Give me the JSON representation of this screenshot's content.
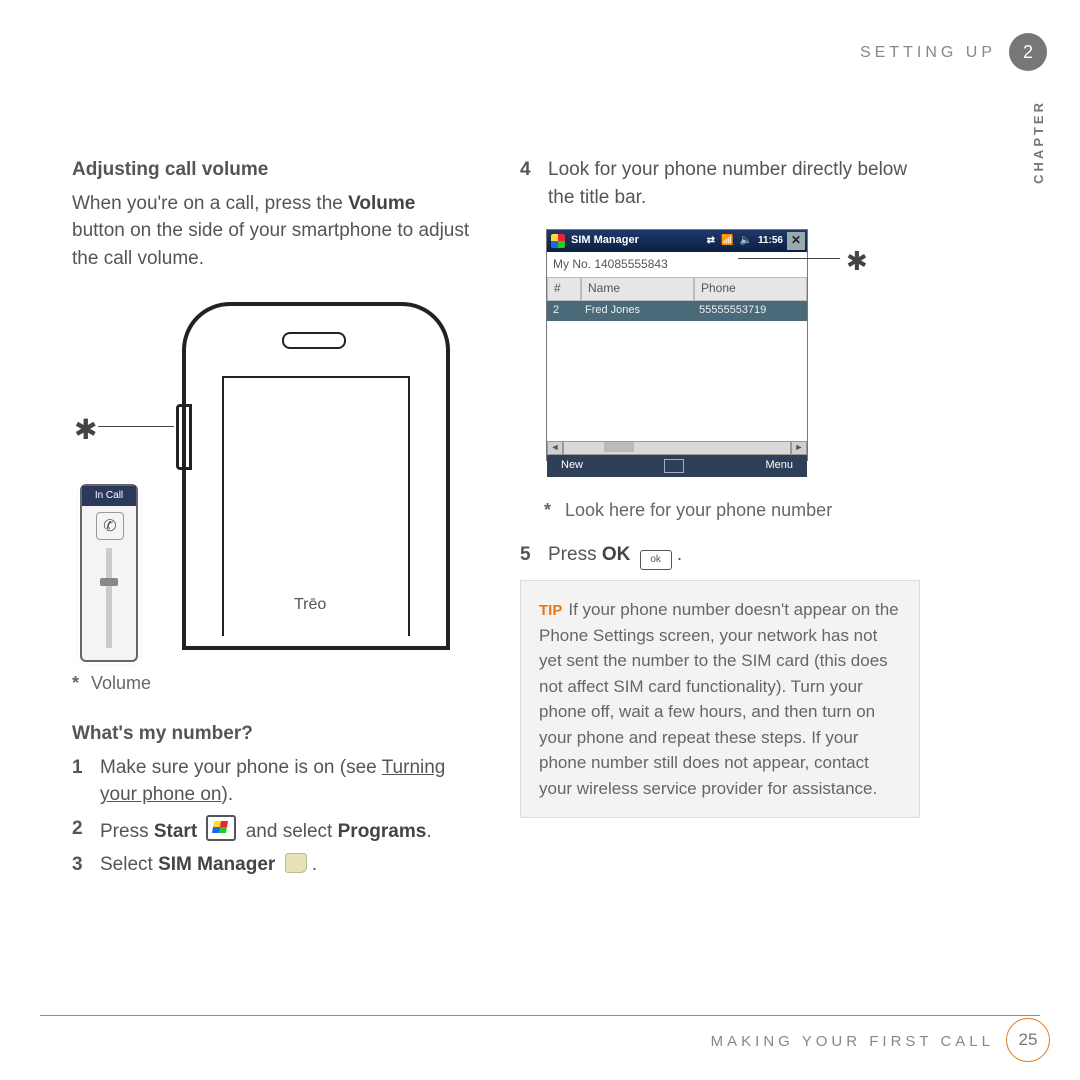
{
  "header": {
    "section": "SETTING UP",
    "chapter_num": "2",
    "side_label": "CHAPTER"
  },
  "footer": {
    "section": "MAKING YOUR FIRST CALL",
    "page": "25"
  },
  "left": {
    "h_adjust": "Adjusting call volume",
    "adjust_body_1": "When you're on a call, press the ",
    "adjust_body_bold": "Volume",
    "adjust_body_2": " button on the side of your smartphone to adjust the call volume.",
    "incall_label": "In Call",
    "phone_logo": "Trēo",
    "caption_volume": "Volume",
    "h_number": "What's my number?",
    "steps": {
      "one_a": "Make sure your phone is on (see ",
      "one_link": "Turning your phone on",
      "one_b": ").",
      "two_a": "Press ",
      "two_start": "Start",
      "two_b": " and select ",
      "two_programs": "Programs",
      "two_c": ".",
      "three_a": "Select ",
      "three_sim": "SIM Manager",
      "three_b": " ."
    }
  },
  "right": {
    "step4": "Look for your phone number directly below the title bar.",
    "sim": {
      "title": "SIM Manager",
      "time": "11:56",
      "myno": "My No. 14085555843",
      "col_hash": "#",
      "col_name": "Name",
      "col_phone": "Phone",
      "row_num": "2",
      "row_name": "Fred Jones",
      "row_phone": "55555553719",
      "soft_left": "New",
      "soft_right": "Menu"
    },
    "caption_look": "Look here for your phone number",
    "step5_a": "Press ",
    "step5_ok": "OK",
    "step5_badge": "ok",
    "step5_b": " .",
    "tip_label": "TIP",
    "tip_body": "If your phone number doesn't appear on the Phone Settings screen, your network has not yet sent the number to the SIM card (this does not affect SIM card functionality). Turn your phone off, wait a few hours, and then turn on your phone and repeat these steps. If your phone number still does not appear, contact your wireless service provider for assistance."
  }
}
